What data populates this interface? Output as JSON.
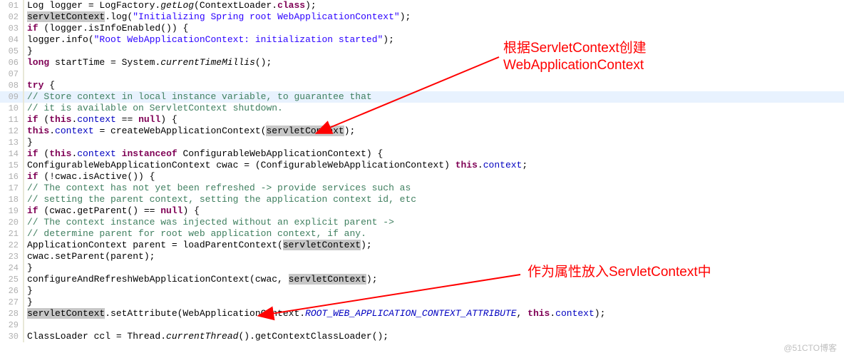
{
  "lines": [
    {
      "n": "01",
      "indent": 8,
      "tokens": [
        {
          "t": "Log logger = LogFactory.",
          "c": ""
        },
        {
          "t": "getLog",
          "c": "mth"
        },
        {
          "t": "(ContextLoader.",
          "c": ""
        },
        {
          "t": "class",
          "c": "kw"
        },
        {
          "t": ");",
          "c": ""
        }
      ]
    },
    {
      "n": "02",
      "indent": 8,
      "tokens": [
        {
          "t": "servletContext",
          "c": "hl"
        },
        {
          "t": ".log(",
          "c": ""
        },
        {
          "t": "\"Initializing Spring root WebApplicationContext\"",
          "c": "str"
        },
        {
          "t": ");",
          "c": ""
        }
      ]
    },
    {
      "n": "03",
      "indent": 8,
      "tokens": [
        {
          "t": "if",
          "c": "kw"
        },
        {
          "t": " (logger.isInfoEnabled()) {",
          "c": ""
        }
      ]
    },
    {
      "n": "04",
      "indent": 12,
      "tokens": [
        {
          "t": "logger.info(",
          "c": ""
        },
        {
          "t": "\"Root WebApplicationContext: initialization started\"",
          "c": "str"
        },
        {
          "t": ");",
          "c": ""
        }
      ]
    },
    {
      "n": "05",
      "indent": 8,
      "tokens": [
        {
          "t": "}",
          "c": ""
        }
      ]
    },
    {
      "n": "06",
      "indent": 8,
      "tokens": [
        {
          "t": "long",
          "c": "kw"
        },
        {
          "t": " startTime = System.",
          "c": ""
        },
        {
          "t": "currentTimeMillis",
          "c": "mth"
        },
        {
          "t": "();",
          "c": ""
        }
      ]
    },
    {
      "n": "07",
      "indent": 8,
      "tokens": []
    },
    {
      "n": "08",
      "indent": 8,
      "tokens": [
        {
          "t": "try",
          "c": "kw"
        },
        {
          "t": " {",
          "c": ""
        }
      ]
    },
    {
      "n": "09",
      "indent": 12,
      "cursor": true,
      "tokens": [
        {
          "t": "// Store context in local instance variable, to guarantee that",
          "c": "cm"
        }
      ]
    },
    {
      "n": "10",
      "indent": 12,
      "tokens": [
        {
          "t": "// it is available on ServletContext shutdown.",
          "c": "cm"
        }
      ]
    },
    {
      "n": "11",
      "indent": 12,
      "tokens": [
        {
          "t": "if",
          "c": "kw"
        },
        {
          "t": " (",
          "c": ""
        },
        {
          "t": "this",
          "c": "kw"
        },
        {
          "t": ".",
          "c": ""
        },
        {
          "t": "context",
          "c": "fld"
        },
        {
          "t": " == ",
          "c": ""
        },
        {
          "t": "null",
          "c": "kw"
        },
        {
          "t": ") {",
          "c": ""
        }
      ]
    },
    {
      "n": "12",
      "indent": 16,
      "tokens": [
        {
          "t": "this",
          "c": "kw"
        },
        {
          "t": ".",
          "c": ""
        },
        {
          "t": "context",
          "c": "fld"
        },
        {
          "t": " = createWebApplicationContext(",
          "c": ""
        },
        {
          "t": "servletContext",
          "c": "hl"
        },
        {
          "t": ");",
          "c": ""
        }
      ]
    },
    {
      "n": "13",
      "indent": 12,
      "tokens": [
        {
          "t": "}",
          "c": ""
        }
      ]
    },
    {
      "n": "14",
      "indent": 12,
      "tokens": [
        {
          "t": "if",
          "c": "kw"
        },
        {
          "t": " (",
          "c": ""
        },
        {
          "t": "this",
          "c": "kw"
        },
        {
          "t": ".",
          "c": ""
        },
        {
          "t": "context",
          "c": "fld"
        },
        {
          "t": " ",
          "c": ""
        },
        {
          "t": "instanceof",
          "c": "kw"
        },
        {
          "t": " ConfigurableWebApplicationContext) {",
          "c": ""
        }
      ]
    },
    {
      "n": "15",
      "indent": 16,
      "tokens": [
        {
          "t": "ConfigurableWebApplicationContext cwac = (ConfigurableWebApplicationContext) ",
          "c": ""
        },
        {
          "t": "this",
          "c": "kw"
        },
        {
          "t": ".",
          "c": ""
        },
        {
          "t": "context",
          "c": "fld"
        },
        {
          "t": ";",
          "c": ""
        }
      ]
    },
    {
      "n": "16",
      "indent": 16,
      "tokens": [
        {
          "t": "if",
          "c": "kw"
        },
        {
          "t": " (!cwac.isActive()) {",
          "c": ""
        }
      ]
    },
    {
      "n": "17",
      "indent": 20,
      "tokens": [
        {
          "t": "// The context has not yet been refreshed -> provide services such as",
          "c": "cm"
        }
      ]
    },
    {
      "n": "18",
      "indent": 20,
      "tokens": [
        {
          "t": "// setting the parent context, setting the application context id, etc",
          "c": "cm"
        }
      ]
    },
    {
      "n": "19",
      "indent": 20,
      "tokens": [
        {
          "t": "if",
          "c": "kw"
        },
        {
          "t": " (cwac.getParent() == ",
          "c": ""
        },
        {
          "t": "null",
          "c": "kw"
        },
        {
          "t": ") {",
          "c": ""
        }
      ]
    },
    {
      "n": "20",
      "indent": 24,
      "tokens": [
        {
          "t": "// The context instance was injected without an explicit parent ->",
          "c": "cm"
        }
      ]
    },
    {
      "n": "21",
      "indent": 24,
      "tokens": [
        {
          "t": "// determine parent for root web application context, if any.",
          "c": "cm"
        }
      ]
    },
    {
      "n": "22",
      "indent": 24,
      "tokens": [
        {
          "t": "ApplicationContext parent = loadParentContext(",
          "c": ""
        },
        {
          "t": "servletContext",
          "c": "hl"
        },
        {
          "t": ");",
          "c": ""
        }
      ]
    },
    {
      "n": "23",
      "indent": 24,
      "tokens": [
        {
          "t": "cwac.setParent(parent);",
          "c": ""
        }
      ]
    },
    {
      "n": "24",
      "indent": 20,
      "tokens": [
        {
          "t": "}",
          "c": ""
        }
      ]
    },
    {
      "n": "25",
      "indent": 20,
      "tokens": [
        {
          "t": "configureAndRefreshWebApplicationContext(cwac, ",
          "c": ""
        },
        {
          "t": "servletContext",
          "c": "hl"
        },
        {
          "t": ");",
          "c": ""
        }
      ]
    },
    {
      "n": "26",
      "indent": 16,
      "tokens": [
        {
          "t": "}",
          "c": ""
        }
      ]
    },
    {
      "n": "27",
      "indent": 12,
      "tokens": [
        {
          "t": "}",
          "c": ""
        }
      ]
    },
    {
      "n": "28",
      "indent": 12,
      "tokens": [
        {
          "t": "servletContext",
          "c": "hl"
        },
        {
          "t": ".setAttribute(WebApplicationContext.",
          "c": ""
        },
        {
          "t": "ROOT_WEB_APPLICATION_CONTEXT_ATTRIBUTE",
          "c": "sta"
        },
        {
          "t": ", ",
          "c": ""
        },
        {
          "t": "this",
          "c": "kw"
        },
        {
          "t": ".",
          "c": ""
        },
        {
          "t": "context",
          "c": "fld"
        },
        {
          "t": ");",
          "c": ""
        }
      ]
    },
    {
      "n": "29",
      "indent": 12,
      "tokens": []
    },
    {
      "n": "30",
      "indent": 12,
      "tokens": [
        {
          "t": "ClassLoader ccl = Thread.",
          "c": ""
        },
        {
          "t": "currentThread",
          "c": "mth"
        },
        {
          "t": "().getContextClassLoader();",
          "c": ""
        }
      ]
    }
  ],
  "annotations": {
    "a1_line1": "根据ServletContext创建",
    "a1_line2": "WebApplicationContext",
    "a2": "作为属性放入ServletContext中"
  },
  "watermark": "@51CTO博客"
}
